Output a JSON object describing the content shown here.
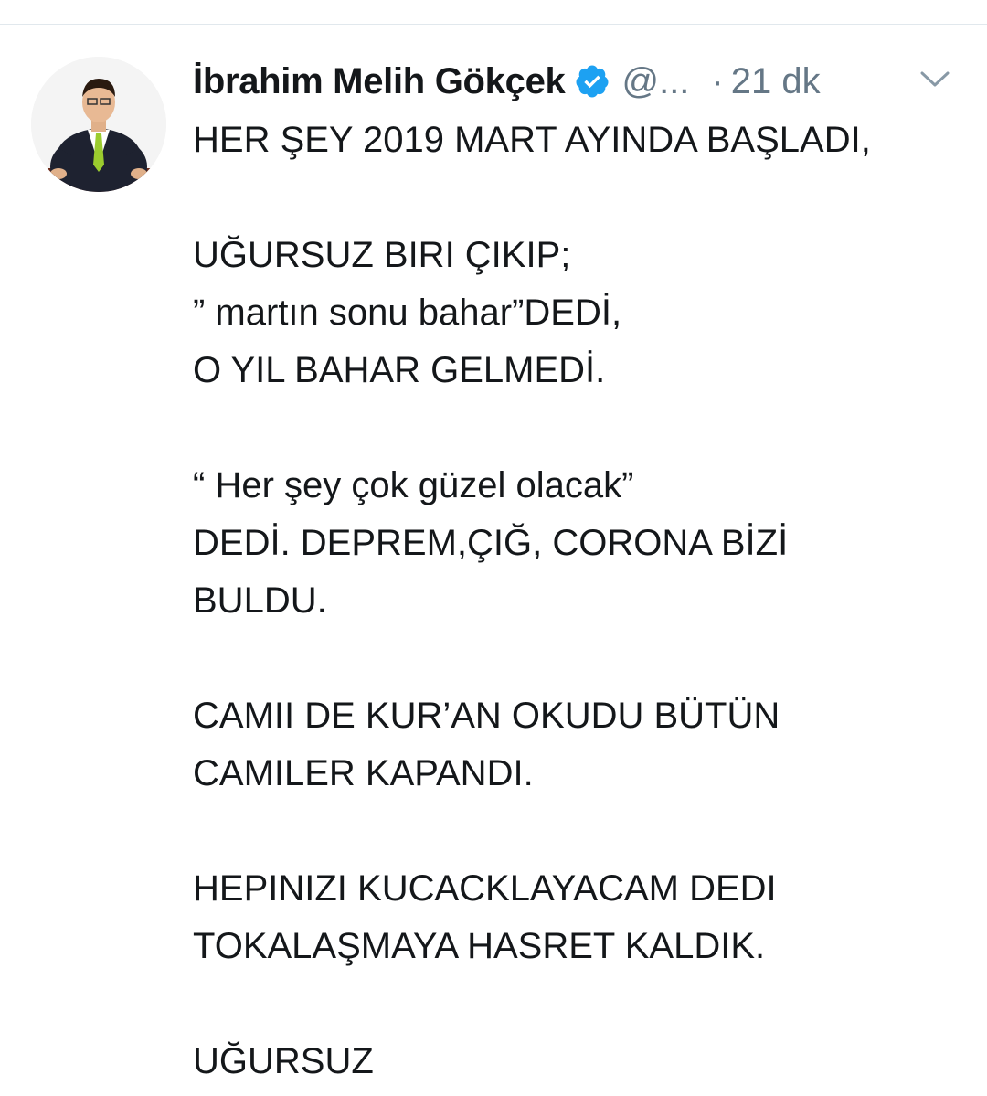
{
  "tweet": {
    "author_name": "İbrahim Melih Gökçek",
    "handle": "@...",
    "separator": "·",
    "time": "21 dk",
    "verified": true,
    "verified_color": "#1da1f2",
    "avatar_icon": "user-avatar-photo",
    "menu_icon": "chevron-down-icon",
    "lines": [
      "HER ŞEY 2019 MART AYINDA BAŞLADI,",
      "",
      "UĞURSUZ BIRI ÇIKIP;",
      "” martın sonu bahar”DEDİ,",
      "O YIL BAHAR GELMEDİ.",
      "",
      "“ Her şey çok güzel olacak”",
      "DEDİ. DEPREM,ÇIĞ, CORONA BİZİ",
      "BULDU.",
      "",
      "CAMII DE KUR’AN OKUDU BÜTÜN",
      "CAMILER KAPANDI.",
      "",
      "HEPINIZI KUCACKLAYACAM DEDI",
      "TOKALAŞMAYA HASRET KALDIK.",
      "",
      "UĞURSUZ"
    ]
  }
}
